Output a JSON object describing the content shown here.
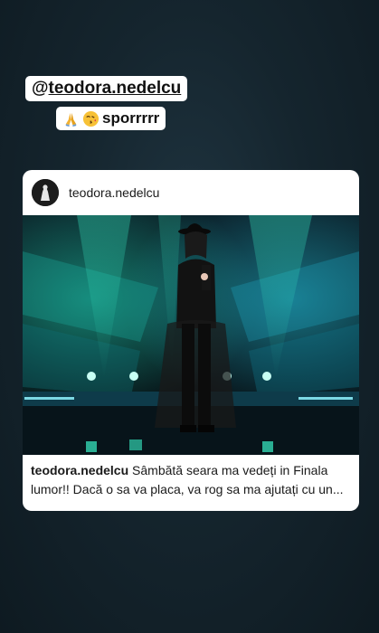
{
  "story": {
    "mention_prefix": "@",
    "mention_user": "teodora.nedelcu",
    "caption_text": "sporrrrr",
    "emojis": [
      "folded-hands-emoji",
      "face-blowing-kiss-emoji"
    ]
  },
  "post": {
    "header_username": "teodora.nedelcu",
    "caption_username": "teodora.nedelcu",
    "caption_text": " Sâmbătă seara ma vedeți in Finala lumor!! Dacă o sa va placa, va rog sa ma ajutați cu un..."
  },
  "colors": {
    "background": "#15252e",
    "card": "#ffffff",
    "stage_glow": "#1fd6b4"
  }
}
